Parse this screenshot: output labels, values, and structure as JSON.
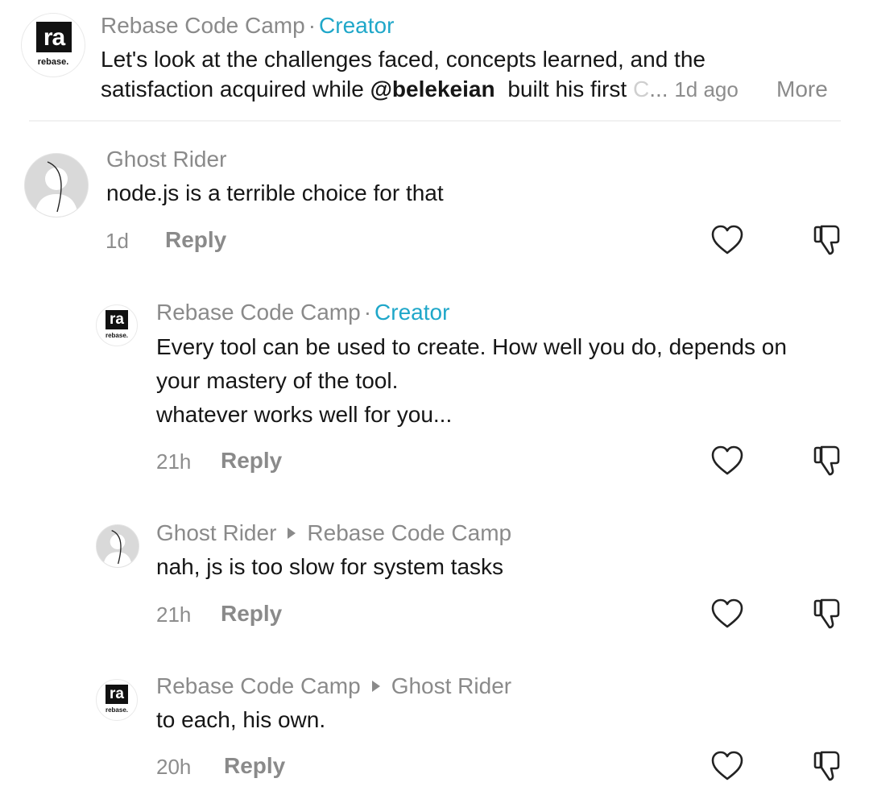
{
  "caption": {
    "author": "Rebase Code Camp",
    "separator": "·",
    "creator_label": "Creator",
    "line1": "Let's look at the challenges faced, concepts learned, and the",
    "line2_before": "satisfaction acquired while ",
    "mention": "@belekeian",
    "line2_after": "built his first",
    "faded": "C",
    "ellipsis": "...",
    "time": "1d ago",
    "more": "More",
    "logo_text": "ra",
    "logo_sub": "rebase."
  },
  "comments": [
    {
      "author": "Ghost Rider",
      "text": "node.js is a terrible choice for that",
      "time": "1d",
      "reply_label": "Reply"
    },
    {
      "author": "Rebase Code Camp",
      "separator": "·",
      "creator_label": "Creator",
      "lines": [
        "Every tool can be used to create. How well you do, depends on",
        "your mastery of the tool.",
        "whatever works well for you..."
      ],
      "time": "21h",
      "reply_label": "Reply",
      "logo_text": "ra",
      "logo_sub": "rebase."
    },
    {
      "author": "Ghost Rider",
      "reply_to": "Rebase Code Camp",
      "text": "nah, js is too slow for system tasks",
      "time": "21h",
      "reply_label": "Reply"
    },
    {
      "author": "Rebase Code Camp",
      "reply_to": "Ghost Rider",
      "text": "to each, his own.",
      "time": "20h",
      "reply_label": "Reply",
      "logo_text": "ra",
      "logo_sub": "rebase."
    }
  ],
  "icons": {
    "like": "heart-outline-icon",
    "dislike": "thumbs-down-outline-icon"
  },
  "colors": {
    "creator": "#1fa7c9",
    "name": "#8a8a8a",
    "text": "#161616"
  }
}
